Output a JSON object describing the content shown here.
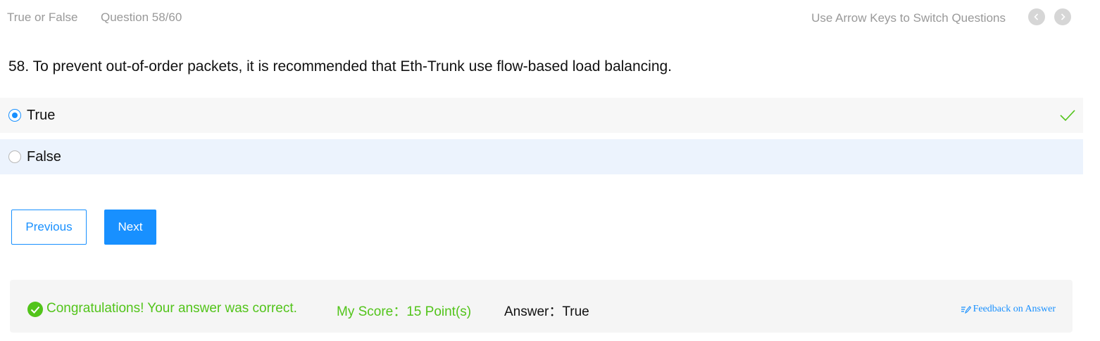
{
  "header": {
    "type_label": "True or False",
    "question_counter": "Question 58/60",
    "hint": "Use Arrow Keys to Switch Questions"
  },
  "question": {
    "text": "58. To prevent out-of-order packets, it is recommended that Eth-Trunk use flow-based load balancing.",
    "options": [
      {
        "label": "True",
        "selected": true,
        "correct": true
      },
      {
        "label": "False",
        "selected": false,
        "correct": false
      }
    ]
  },
  "buttons": {
    "previous": "Previous",
    "next": "Next"
  },
  "result": {
    "message": "Congratulations! Your answer was correct.",
    "score": "My Score：15 Point(s)",
    "answer": "Answer：True",
    "feedback_link": "Feedback on Answer"
  },
  "colors": {
    "accent": "#1890ff",
    "success": "#52c41a",
    "muted_text": "#999999"
  },
  "icons": {
    "prev_nav": "chevron-left-icon",
    "next_nav": "chevron-right-icon",
    "correct": "checkmark-icon",
    "result": "check-circle-icon",
    "feedback": "edit-lines-icon"
  }
}
